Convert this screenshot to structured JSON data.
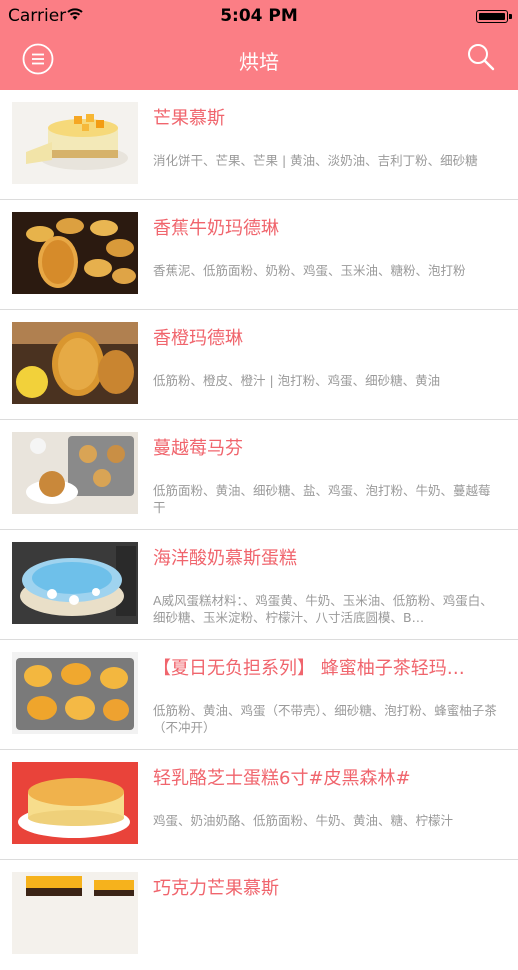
{
  "status": {
    "carrier": "Carrier",
    "time": "5:04 PM"
  },
  "nav": {
    "title": "烘培",
    "menu_icon": "menu-icon",
    "search_icon": "search-icon"
  },
  "colors": {
    "accent": "#fb7e85",
    "title_text": "#f0656d",
    "desc_text": "#9a9a9a"
  },
  "recipes": [
    {
      "title": "芒果慕斯",
      "desc": "消化饼干、芒果、芒果 | 黄油、淡奶油、吉利丁粉、细砂糖"
    },
    {
      "title": "香蕉牛奶玛德琳",
      "desc": "香蕉泥、低筋面粉、奶粉、鸡蛋、玉米油、糖粉、泡打粉"
    },
    {
      "title": "香橙玛德琳",
      "desc": "低筋粉、橙皮、橙汁 | 泡打粉、鸡蛋、细砂糖、黄油"
    },
    {
      "title": "蔓越莓马芬",
      "desc": "低筋面粉、黄油、细砂糖、盐、鸡蛋、泡打粉、牛奶、蔓越莓干"
    },
    {
      "title": "海洋酸奶慕斯蛋糕",
      "desc": "A威风蛋糕材料：、鸡蛋黄、牛奶、玉米油、低筋粉、鸡蛋白、细砂糖、玉米淀粉、柠檬汁、八寸活底圆模、B…"
    },
    {
      "title": "【夏日无负担系列】 蜂蜜柚子茶轻玛…",
      "desc": "低筋粉、黄油、鸡蛋（不带壳）、细砂糖、泡打粉、蜂蜜柚子茶（不冲开）"
    },
    {
      "title": "轻乳酪芝士蛋糕6寸#皮黑森林#",
      "desc": "鸡蛋、奶油奶酪、低筋面粉、牛奶、黄油、糖、柠檬汁"
    },
    {
      "title": "巧克力芒果慕斯",
      "desc": ""
    }
  ]
}
